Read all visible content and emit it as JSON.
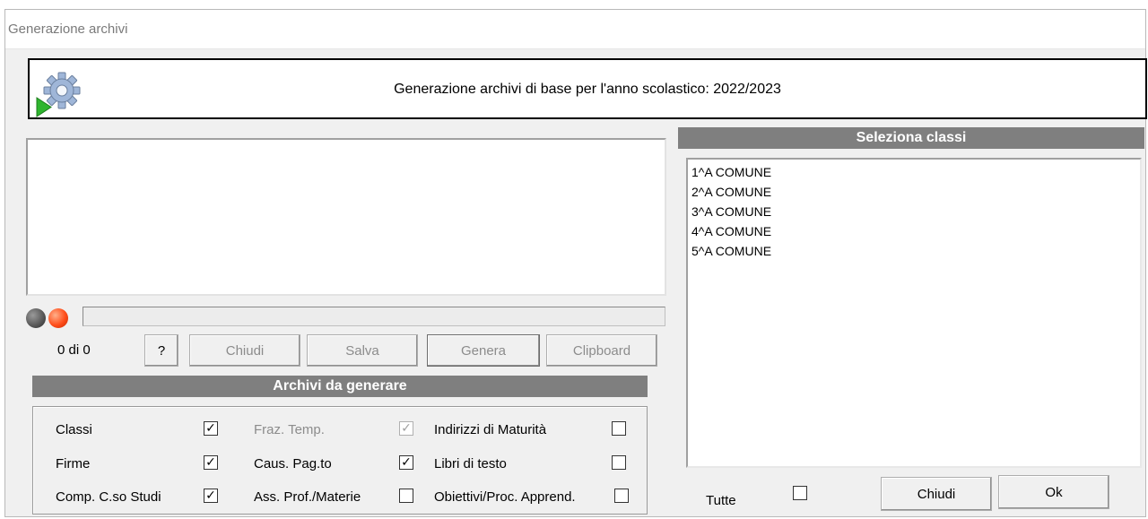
{
  "window": {
    "title": "Generazione archivi"
  },
  "header": {
    "text": "Generazione archivi di base per l'anno scolastico: 2022/2023",
    "icon": "gear-play-icon"
  },
  "status": {
    "counter": "0 di 0",
    "progress_percent": 0
  },
  "actions": {
    "help": "?",
    "chiudi": "Chiudi",
    "salva": "Salva",
    "genera": "Genera",
    "clipboard": "Clipboard"
  },
  "archivi": {
    "title": "Archivi da generare",
    "items": [
      {
        "label": "Classi",
        "checked": true,
        "enabled": true
      },
      {
        "label": "Fraz. Temp.",
        "checked": true,
        "enabled": false
      },
      {
        "label": "Indirizzi di Maturità",
        "checked": false,
        "enabled": true
      },
      {
        "label": "Firme",
        "checked": true,
        "enabled": true
      },
      {
        "label": "Caus. Pag.to",
        "checked": true,
        "enabled": true
      },
      {
        "label": "Libri di testo",
        "checked": false,
        "enabled": true
      },
      {
        "label": "Comp. C.so Studi",
        "checked": true,
        "enabled": true
      },
      {
        "label": "Ass. Prof./Materie",
        "checked": false,
        "enabled": true
      },
      {
        "label": "Obiettivi/Proc. Apprend.",
        "checked": false,
        "enabled": true
      }
    ]
  },
  "classi": {
    "title": "Seleziona classi",
    "items": [
      "1^A COMUNE",
      "2^A COMUNE",
      "3^A COMUNE",
      "4^A COMUNE",
      "5^A COMUNE"
    ],
    "tutte_label": "Tutte",
    "tutte_checked": false
  },
  "dialog_buttons": {
    "chiudi": "Chiudi",
    "ok": "Ok"
  },
  "colors": {
    "section_header": "#7f7f7f",
    "led_gray": "#555555",
    "led_red": "#ff4d1a"
  }
}
